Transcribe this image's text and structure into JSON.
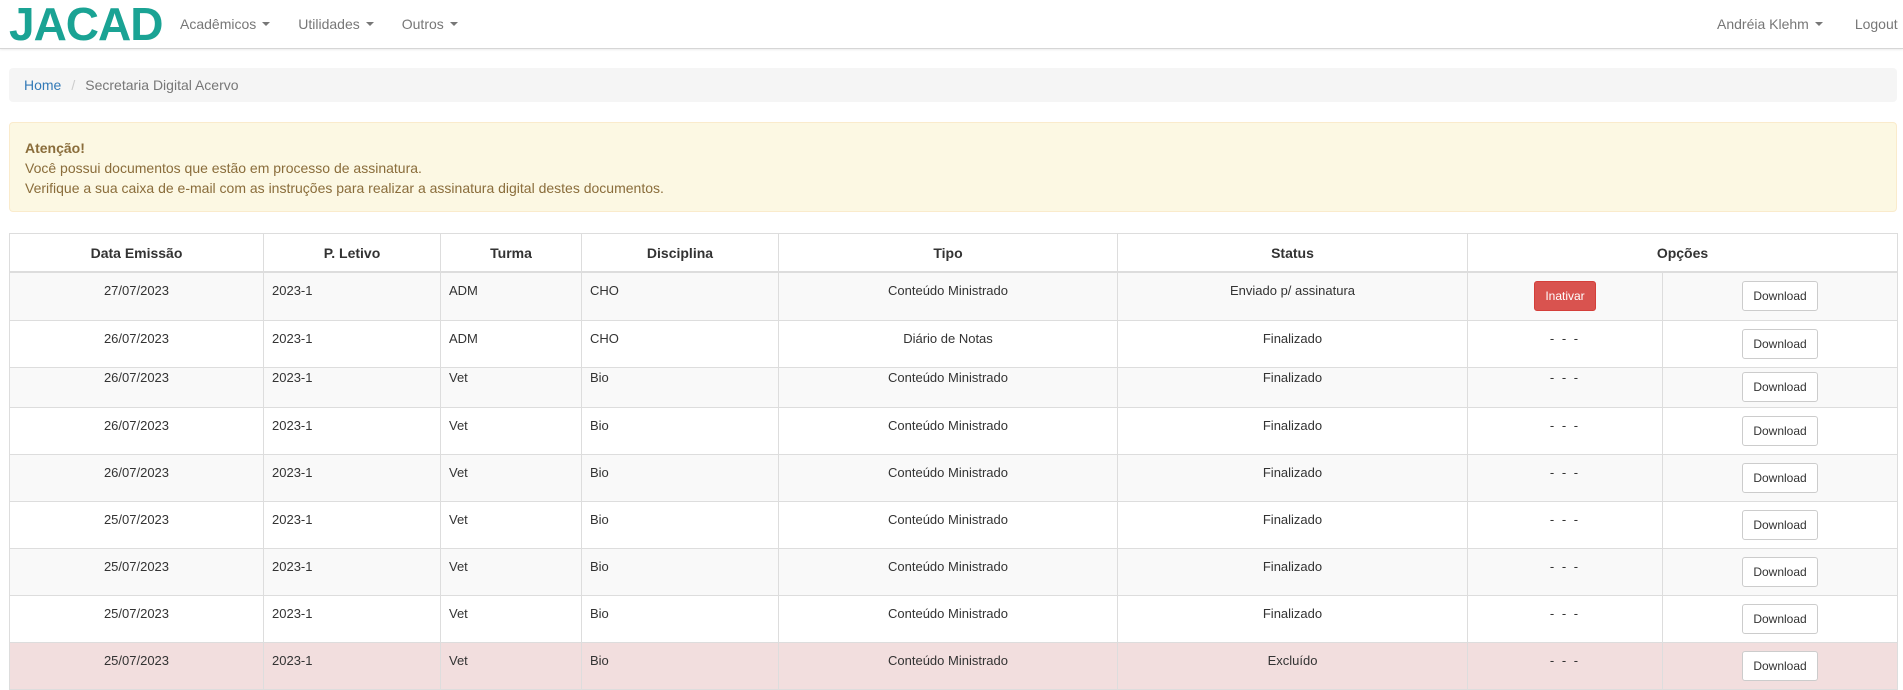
{
  "navbar": {
    "brand": "JACAD",
    "menus": [
      {
        "label": "Acadêmicos"
      },
      {
        "label": "Utilidades"
      },
      {
        "label": "Outros"
      }
    ],
    "user": "Andréia Klehm",
    "logout": "Logout",
    "accent_color": "#1aa394"
  },
  "breadcrumb": {
    "home": "Home",
    "current": "Secretaria Digital Acervo"
  },
  "alert": {
    "title": "Atenção!",
    "line1": "Você possui documentos que estão em processo de assinatura.",
    "line2": "Verifique a sua caixa de e-mail com as instruções para realizar a assinatura digital destes documentos."
  },
  "table": {
    "headers": [
      "Data Emissão",
      "P. Letivo",
      "Turma",
      "Disciplina",
      "Tipo",
      "Status",
      "Opções"
    ],
    "rows": [
      {
        "data": "27/07/2023",
        "letivo": "2023-1",
        "turma": "ADM",
        "disciplina": "CHO",
        "tipo": "Conteúdo Ministrado",
        "status": "Enviado p/ assinatura",
        "opcao": "Inativar",
        "download": "Download"
      },
      {
        "data": "26/07/2023",
        "letivo": "2023-1",
        "turma": "ADM",
        "disciplina": "CHO",
        "tipo": "Diário de Notas",
        "status": "Finalizado",
        "opcao": "- - -",
        "download": "Download"
      },
      {
        "data": "26/07/2023",
        "letivo": "2023-1",
        "turma": "Vet",
        "disciplina": "Bio",
        "tipo": "Conteúdo Ministrado",
        "status": "Finalizado",
        "opcao": "- - -",
        "download": "Download"
      },
      {
        "data": "26/07/2023",
        "letivo": "2023-1",
        "turma": "Vet",
        "disciplina": "Bio",
        "tipo": "Conteúdo Ministrado",
        "status": "Finalizado",
        "opcao": "- - -",
        "download": "Download"
      },
      {
        "data": "26/07/2023",
        "letivo": "2023-1",
        "turma": "Vet",
        "disciplina": "Bio",
        "tipo": "Conteúdo Ministrado",
        "status": "Finalizado",
        "opcao": "- - -",
        "download": "Download"
      },
      {
        "data": "25/07/2023",
        "letivo": "2023-1",
        "turma": "Vet",
        "disciplina": "Bio",
        "tipo": "Conteúdo Ministrado",
        "status": "Finalizado",
        "opcao": "- - -",
        "download": "Download"
      },
      {
        "data": "25/07/2023",
        "letivo": "2023-1",
        "turma": "Vet",
        "disciplina": "Bio",
        "tipo": "Conteúdo Ministrado",
        "status": "Finalizado",
        "opcao": "- - -",
        "download": "Download"
      },
      {
        "data": "25/07/2023",
        "letivo": "2023-1",
        "turma": "Vet",
        "disciplina": "Bio",
        "tipo": "Conteúdo Ministrado",
        "status": "Finalizado",
        "opcao": "- - -",
        "download": "Download"
      },
      {
        "data": "25/07/2023",
        "letivo": "2023-1",
        "turma": "Vet",
        "disciplina": "Bio",
        "tipo": "Conteúdo Ministrado",
        "status": "Excluído",
        "opcao": "- - -",
        "download": "Download"
      }
    ]
  }
}
